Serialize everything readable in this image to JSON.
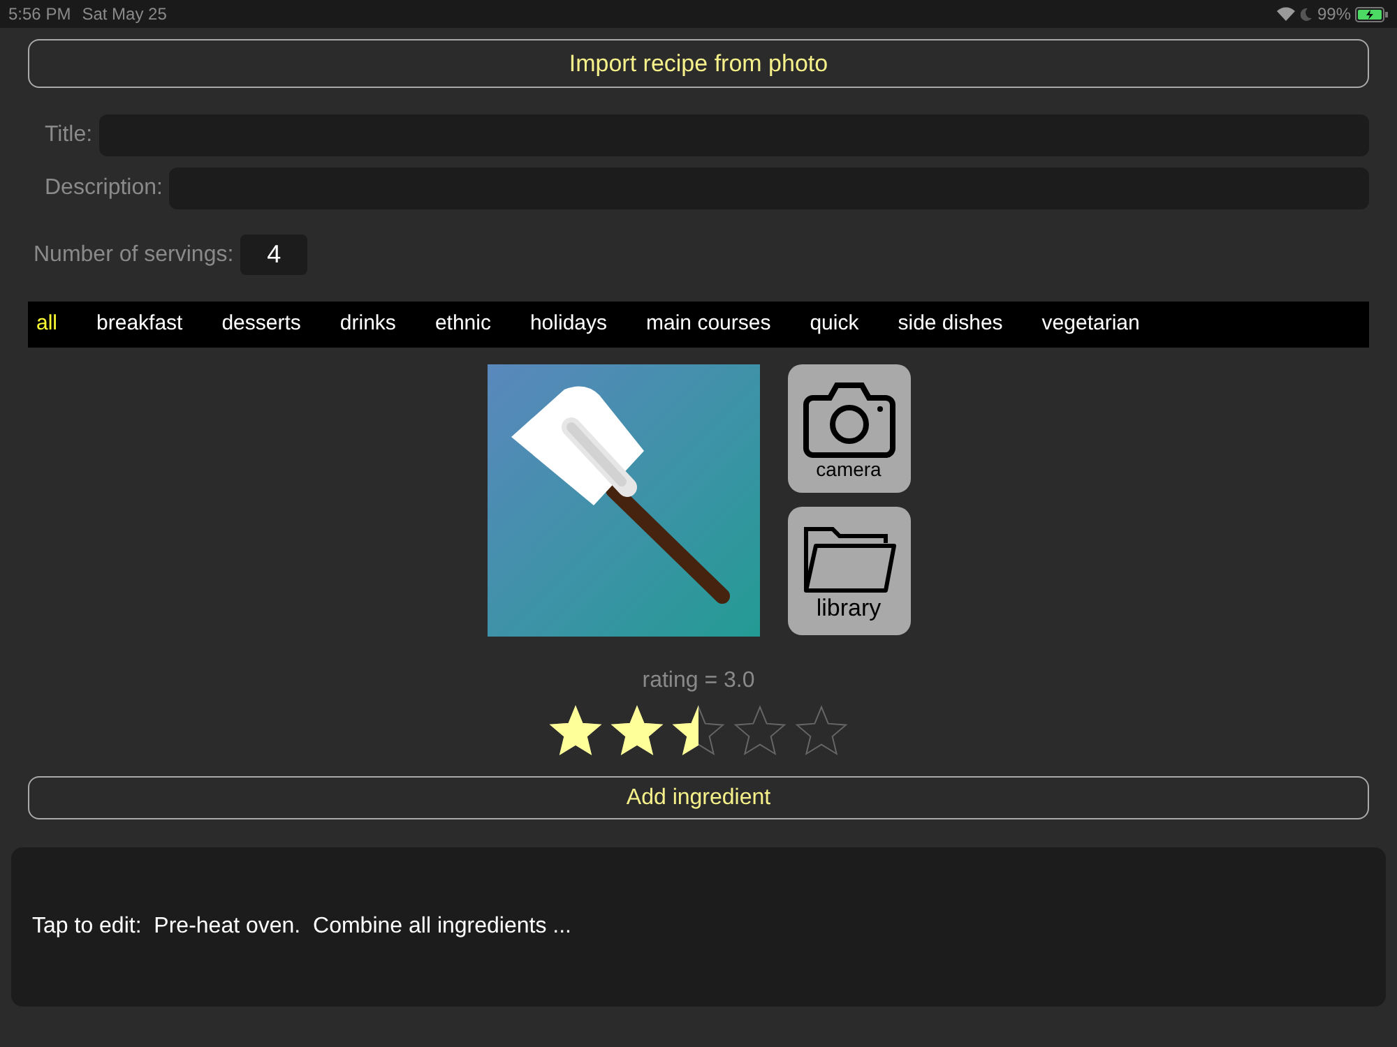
{
  "status_bar": {
    "time": "5:56 PM",
    "date": "Sat May 25",
    "battery": "99%"
  },
  "import_button": "Import recipe from photo",
  "fields": [
    {
      "label": "Title:"
    },
    {
      "label": "Description:"
    }
  ],
  "servings": {
    "label": "Number of servings:",
    "value": "4"
  },
  "categories": [
    {
      "label": "all",
      "selected": true
    },
    {
      "label": "breakfast",
      "selected": false
    },
    {
      "label": "desserts",
      "selected": false
    },
    {
      "label": "drinks",
      "selected": false
    },
    {
      "label": "ethnic",
      "selected": false
    },
    {
      "label": "holidays",
      "selected": false
    },
    {
      "label": "main courses",
      "selected": false
    },
    {
      "label": "quick",
      "selected": false
    },
    {
      "label": "side dishes",
      "selected": false
    },
    {
      "label": "vegetarian",
      "selected": false
    }
  ],
  "photo_buttons": [
    {
      "kind": "camera",
      "label": "camera"
    },
    {
      "kind": "library",
      "label": "library"
    }
  ],
  "rating": {
    "text": "rating = 3.0",
    "stars": 2.5
  },
  "add_ingredient_button": "Add ingredient",
  "instructions": "Tap to edit:  Pre-heat oven.  Combine all ingredients ..."
}
